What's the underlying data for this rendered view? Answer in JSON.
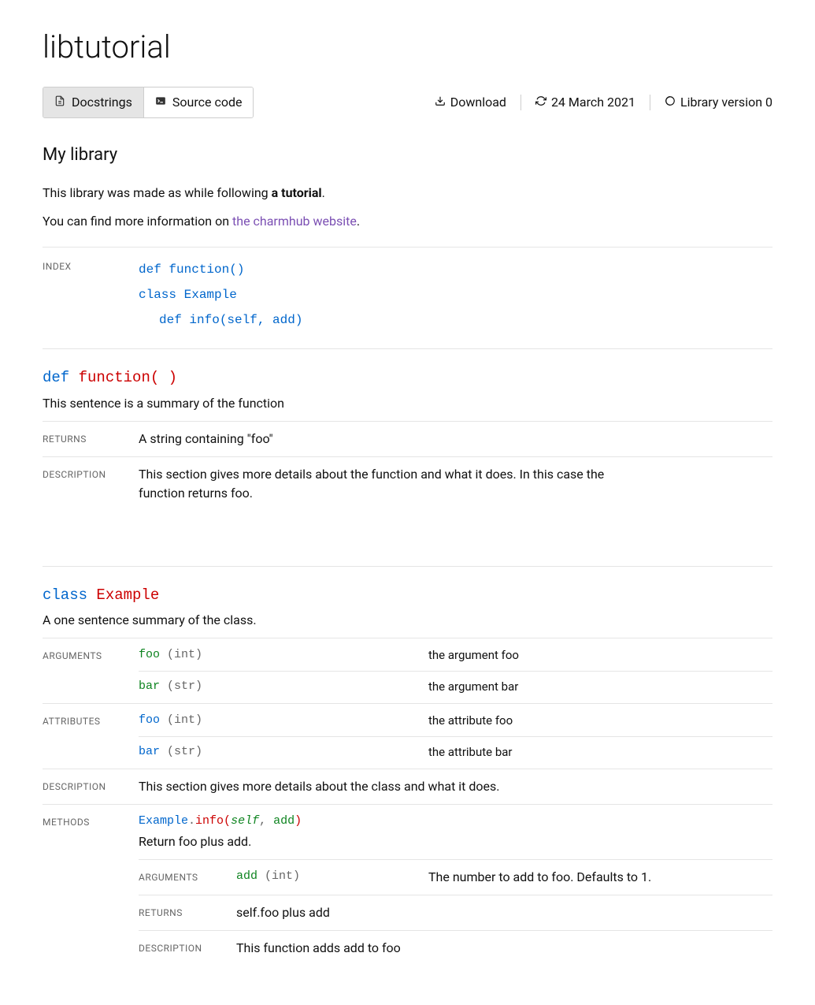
{
  "page": {
    "title": "libtutorial",
    "subtitle": "My library",
    "intro_prefix": "This library was made as while following ",
    "intro_link": "a tutorial",
    "intro_suffix": ".",
    "more_prefix": "You can find more information on ",
    "more_link": "the charmhub website",
    "more_suffix": "."
  },
  "tabs": {
    "docstrings": "Docstrings",
    "source": "Source code"
  },
  "meta": {
    "download": "Download",
    "date": "24 March 2021",
    "version": "Library version 0"
  },
  "labels": {
    "index": "INDEX",
    "returns": "RETURNS",
    "description": "DESCRIPTION",
    "arguments": "ARGUMENTS",
    "attributes": "ATTRIBUTES",
    "methods": "METHODS"
  },
  "index": {
    "item0": "def function()",
    "item1": "class Example",
    "item2": "def info(self, add)"
  },
  "func": {
    "kw": "def",
    "name": "function( )",
    "summary": "This sentence is a summary of the function",
    "returns": "A string containing \"foo\"",
    "description": "This section gives more details about the function and what it does. In this case the function returns foo."
  },
  "cls": {
    "kw": "class",
    "name": "Example",
    "summary": "A one sentence summary of the class.",
    "args": {
      "foo_name": "foo",
      "foo_type": "(int)",
      "foo_desc": "the argument foo",
      "bar_name": "bar",
      "bar_type": "(str)",
      "bar_desc": "the argument bar"
    },
    "attrs": {
      "foo_name": "foo",
      "foo_type": "(int)",
      "foo_desc": "the attribute foo",
      "bar_name": "bar",
      "bar_type": "(str)",
      "bar_desc": "the attribute bar"
    },
    "description": "This section gives more details about the class and what it does."
  },
  "method": {
    "class": "Example",
    "name": "info",
    "summary": "Return foo plus add.",
    "arg_name": "add",
    "arg_type": "(int)",
    "arg_desc": "The number to add to foo. Defaults to 1.",
    "returns": "self.foo plus add",
    "description": "This function adds add to foo"
  }
}
